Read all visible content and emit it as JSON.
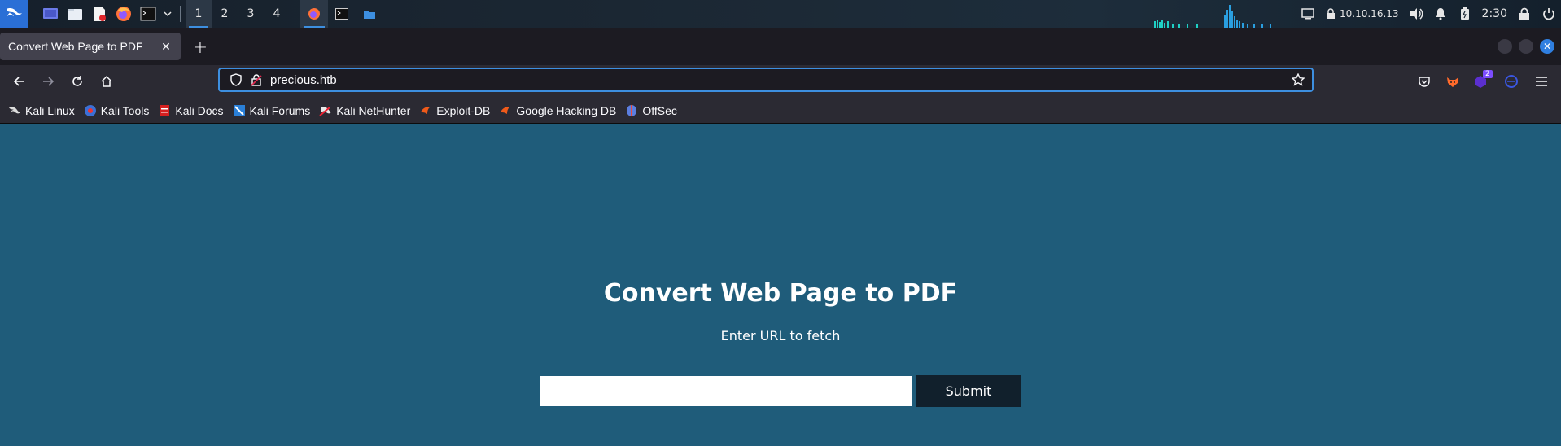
{
  "panel": {
    "workspaces": [
      "1",
      "2",
      "3",
      "4"
    ],
    "active_workspace": "1",
    "tray": {
      "ip": "10.10.16.13",
      "clock": "2:30"
    },
    "icons": [
      "kali-menu-icon",
      "desktop-icon",
      "file-manager-icon",
      "text-editor-icon",
      "firefox-icon",
      "terminal-icon",
      "chevron-down-icon"
    ],
    "graph_color": "#1fd1c5"
  },
  "browser": {
    "tab": {
      "title": "Convert Web Page to PDF"
    },
    "url": "precious.htb",
    "notification_badge": "2",
    "bookmarks": [
      {
        "label": "Kali Linux",
        "icon": "kali-dragon-icon"
      },
      {
        "label": "Kali Tools",
        "icon": "kali-tools-icon"
      },
      {
        "label": "Kali Docs",
        "icon": "kali-docs-icon"
      },
      {
        "label": "Kali Forums",
        "icon": "kali-forums-icon"
      },
      {
        "label": "Kali NetHunter",
        "icon": "nethunter-icon"
      },
      {
        "label": "Exploit-DB",
        "icon": "exploit-db-icon"
      },
      {
        "label": "Google Hacking DB",
        "icon": "ghdb-icon"
      },
      {
        "label": "OffSec",
        "icon": "offsec-icon"
      }
    ]
  },
  "page": {
    "title": "Convert Web Page to PDF",
    "subtitle": "Enter URL to fetch",
    "url_input_value": "",
    "submit_label": "Submit",
    "background": "#1f5c7a",
    "button_color": "#11202c"
  }
}
